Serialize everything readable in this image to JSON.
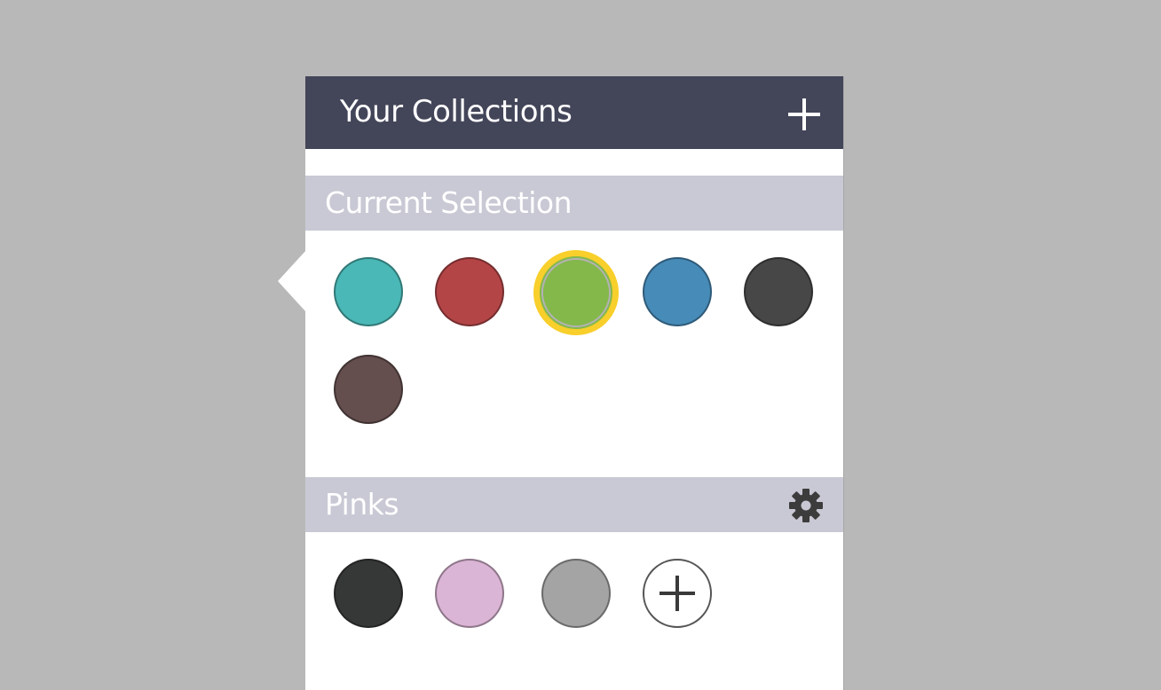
{
  "header": {
    "title": "Your Collections"
  },
  "sections": [
    {
      "title": "Current Selection",
      "swatches": [
        {
          "color": "#4ab8b6"
        },
        {
          "color": "#b44547"
        },
        {
          "color": "#84b84b",
          "selected": true
        },
        {
          "color": "#478bb8"
        },
        {
          "color": "#474747"
        },
        {
          "color": "#644e4e"
        }
      ]
    },
    {
      "title": "Pinks",
      "swatches": [
        {
          "color": "#363837"
        },
        {
          "color": "#dbb5d5"
        },
        {
          "color": "#a4a4a4"
        }
      ]
    }
  ],
  "colors": {
    "header_bg": "#434559",
    "section_bg": "#c9c9d5",
    "selected_ring": "#f8cf2b"
  },
  "icons": {
    "header_add": "plus-icon",
    "settings": "gear-icon",
    "add_color": "plus-icon"
  }
}
